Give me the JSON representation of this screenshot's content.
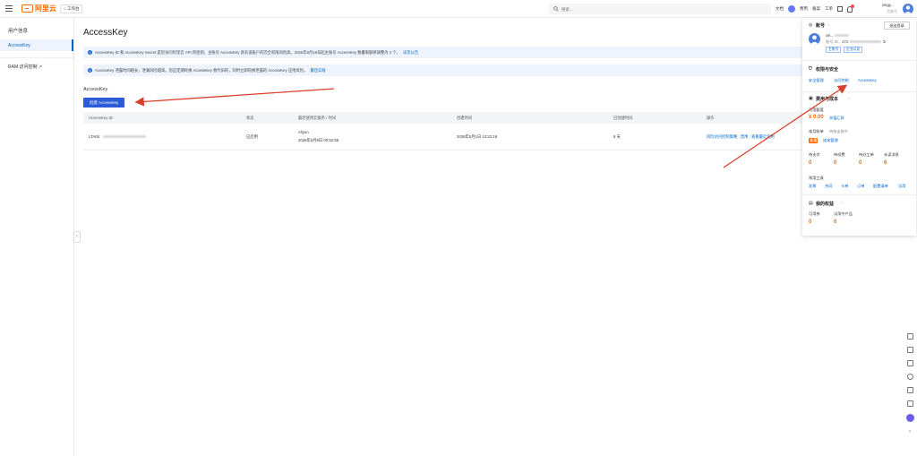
{
  "topbar": {
    "logo_text": "阿里云",
    "workbench": "工作台",
    "search_placeholder": "搜索...",
    "links": [
      "文档",
      "费用",
      "备案",
      "工单"
    ],
    "user_name": "xingy...",
    "user_role": "主账号"
  },
  "sidebar": {
    "title": "用户信息",
    "active_item": "AccessKey",
    "ram_item": "RAM 访问控制"
  },
  "main": {
    "page_title": "AccessKey",
    "notice1_text": "AccessKey ID 和 AccessKey Secret 是您访问阿里云 API 的密钥，主账号 AccessKey 具有该账户的完全权限风险高。2025年8月18日起主账号 AccessKey 数量限额将调整为 2 个。",
    "notice1_link": "详见公告",
    "notice2_text": "AccessKey 泄露时间越长，泄漏风险越高。您应定期轮换 AccessKey 替代旧的，同时立即轮换泄露的 AccessKey 应用风险。",
    "notice2_link": "最佳实践",
    "section_title": "AccessKey",
    "create_button": "创建 AccessKey",
    "table": {
      "headers": [
        "AccessKey ID",
        "状态",
        "最后使用云服务 / 时间",
        "创建时间",
        "已创建时间",
        "操作"
      ],
      "rows": [
        {
          "id": "LTAI5t",
          "status": "已启用",
          "last_service": "Aliyun",
          "last_time": "2026年5月8日 00:52:55",
          "created": "2026年5月1日 13:22:19",
          "age": "8 天",
          "op1": "风险访问控制策略",
          "op2": "禁用",
          "op3": "查看最近调用"
        }
      ]
    }
  },
  "panel": {
    "account_title": "账号",
    "logout": "退出登录",
    "account_name": "xin...",
    "account_id_label": "账号 ID:",
    "account_id": "174",
    "tag_main": "主账号",
    "tag_company": "企业认证",
    "security_title": "权限与安全",
    "security_links": [
      "安全管理",
      "访问控制",
      "AccessKey"
    ],
    "cost_title": "费用与成本",
    "balance_label": "可用额度",
    "balance_value": "¥ 0.00",
    "recharge": "充值汇款",
    "cost_label": "本月账单",
    "cost_hint": "待核出账中",
    "cost_tag": "查看",
    "cost_manage": "成本管理",
    "stats": [
      {
        "label": "待支付",
        "value": "0"
      },
      {
        "label": "待续费",
        "value": "0"
      },
      {
        "label": "待办工单",
        "value": "0"
      },
      {
        "label": "未读消息",
        "value": "6"
      }
    ],
    "tools_label": "常用工具",
    "tools": [
      "发票",
      "合同",
      "卡券",
      "订单",
      "配置清单",
      "试用"
    ],
    "benefits_title": "我的权益",
    "benefits": [
      {
        "label": "可用券",
        "value": "0"
      },
      {
        "label": "试用中产品",
        "value": "0"
      }
    ]
  },
  "colors": {
    "accent": "#0064c8",
    "button": "#2b5bd6",
    "brand": "#ff6a00",
    "annotation_arrow": "#d9402b"
  }
}
